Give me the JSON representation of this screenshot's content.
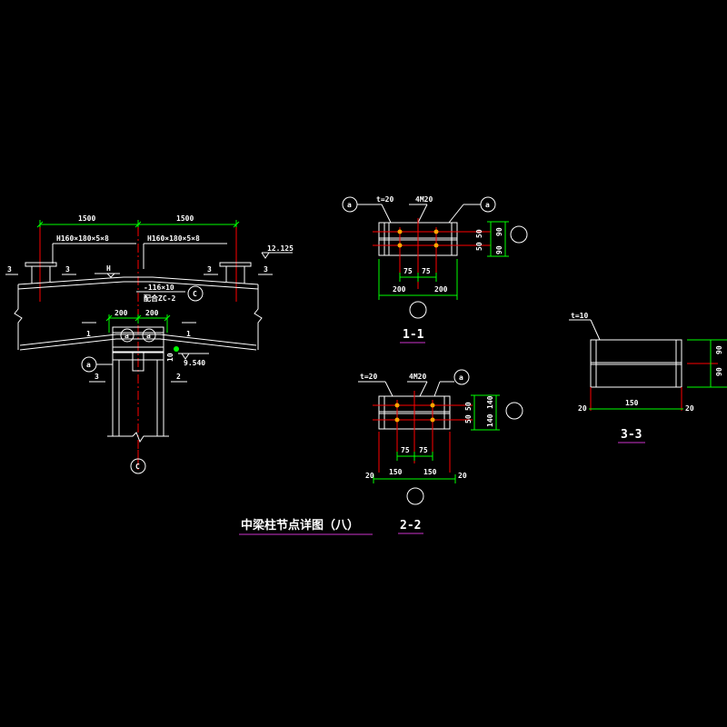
{
  "colors": {
    "background": "#000000",
    "line": "#ffffff",
    "dimension": "#00ff00",
    "centerline": "#ff0000",
    "bolt": "#ffa500",
    "underline": "#cc33cc"
  },
  "elevation_view": {
    "dim_left": "1500",
    "dim_right": "1500",
    "member_left": "H160×180×5×8",
    "member_right": "H160×180×5×8",
    "elev_top": "12.125",
    "elev_bottom": "9.540",
    "plate_note": "-116×10",
    "brace_note": "配合ZC-2",
    "dim_200_left": "200",
    "dim_200_right": "200",
    "thickness": "10",
    "label_H": "H",
    "label_1": "1",
    "label_2": "2",
    "label_3": "3",
    "bubble_a": "a",
    "bubble_c": "C"
  },
  "section_1_1": {
    "title": "1-1",
    "thk": "t=20",
    "bolts": "4M20",
    "bubble_a": "a",
    "d75": "75",
    "d200": "200",
    "d50": "50",
    "d90": "90"
  },
  "section_2_2": {
    "title": "2-2",
    "thk": "t=20",
    "bolts": "4M20",
    "bubble_a": "a",
    "d75": "75",
    "d150": "150",
    "d20": "20",
    "d50": "50",
    "d140": "140"
  },
  "section_3_3": {
    "title": "3-3",
    "thk": "t=10",
    "d150": "150",
    "d20": "20",
    "d90": "90"
  },
  "drawing_title": "中梁柱节点详图（八）"
}
